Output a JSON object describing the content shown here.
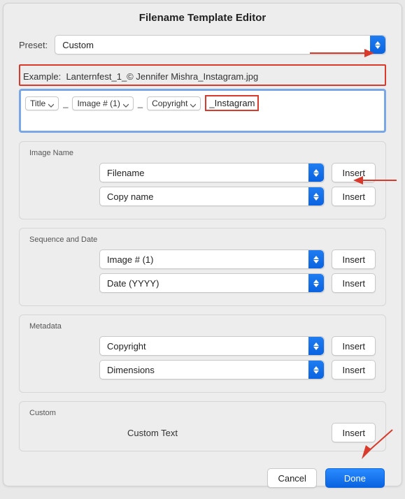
{
  "title": "Filename Template Editor",
  "preset": {
    "label": "Preset:",
    "value": "Custom"
  },
  "example": {
    "prefix": "Example:",
    "value": "Lanternfest_1_© Jennifer Mishra_Instagram.jpg"
  },
  "tokens": {
    "title": "Title",
    "image_num": "Image # (1)",
    "copyright": "Copyright",
    "literal": "_Instagram",
    "sep": "_"
  },
  "sections": {
    "image_name": {
      "title": "Image Name",
      "options": {
        "filename": "Filename",
        "copy_name": "Copy name"
      }
    },
    "sequence_date": {
      "title": "Sequence and Date",
      "options": {
        "image_num": "Image # (1)",
        "date": "Date (YYYY)"
      }
    },
    "metadata": {
      "title": "Metadata",
      "options": {
        "copyright": "Copyright",
        "dimensions": "Dimensions"
      }
    },
    "custom": {
      "title": "Custom",
      "label": "Custom Text"
    }
  },
  "buttons": {
    "insert": "Insert",
    "cancel": "Cancel",
    "done": "Done"
  },
  "colors": {
    "accent": "#0a63e0",
    "annotate": "#d93a2b"
  }
}
